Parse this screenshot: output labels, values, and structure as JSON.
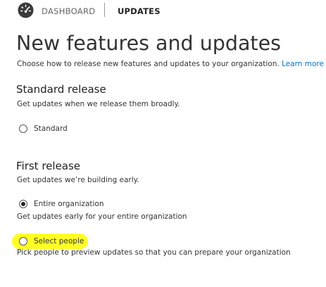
{
  "nav": {
    "dashboard_label": "DASHBOARD",
    "updates_label": "UPDATES"
  },
  "page": {
    "title": "New features and updates",
    "intro": "Choose how to release new features and updates to your organization.",
    "learn_more": "Learn more"
  },
  "standard": {
    "title": "Standard release",
    "description": "Get updates when we release them broadly.",
    "option_label": "Standard",
    "selected": false
  },
  "first_release": {
    "title": "First release",
    "description": "Get updates we’re building early.",
    "options": [
      {
        "label": "Entire organization",
        "description": "Get updates early for your entire organization",
        "selected": true
      },
      {
        "label": "Select people",
        "description": "Pick people to preview updates so that you can prepare your organization",
        "selected": false,
        "highlighted": true
      }
    ]
  },
  "colors": {
    "link": "#0072c6",
    "highlight": "#ffff00",
    "text": "#333333"
  },
  "icons": {
    "dashboard": "gauge-icon"
  }
}
